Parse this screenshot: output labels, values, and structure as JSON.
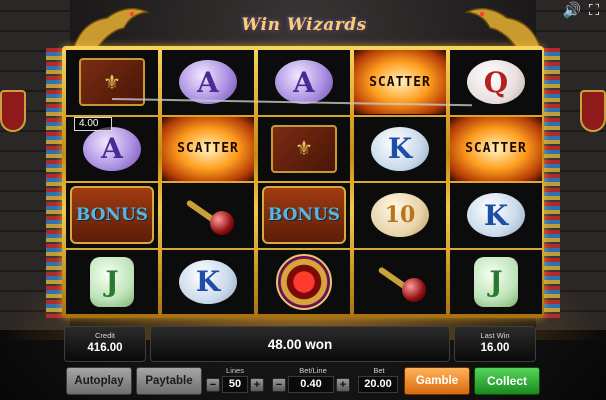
{
  "game": {
    "title": "Win Wizards"
  },
  "top_icons": {
    "sound": "speaker-icon",
    "fullscreen": "fullscreen-icon"
  },
  "reels": [
    [
      "book",
      "A",
      "bonus",
      "J"
    ],
    [
      "A",
      "scatter",
      "wand",
      "K"
    ],
    [
      "A",
      "book",
      "bonus",
      "amulet"
    ],
    [
      "scatter",
      "K",
      "10",
      "wand"
    ],
    [
      "Q",
      "scatter",
      "K",
      "J"
    ]
  ],
  "symbol_labels": {
    "A": "A",
    "K": "K",
    "Q": "Q",
    "J": "J",
    "10": "10",
    "scatter": "SCATTER",
    "bonus": "BONUS"
  },
  "win_line_badge": "4.00",
  "hud": {
    "credit_label": "Credit",
    "credit_value": "416.00",
    "won_text": "48.00 won",
    "last_win_label": "Last Win",
    "last_win_value": "16.00"
  },
  "controls": {
    "autoplay_label": "Autoplay",
    "paytable_label": "Paytable",
    "lines_label": "Lines",
    "lines_value": "50",
    "bet_line_label": "Bet/Line",
    "bet_line_value": "0.40",
    "bet_label": "Bet",
    "bet_value": "20.00",
    "gamble_label": "Gamble",
    "collect_label": "Collect",
    "minus": "−",
    "plus": "+"
  },
  "colors": {
    "gold_frame": "#f3c94b",
    "gamble_orange": "#d96a0f",
    "collect_green": "#1b8a1f"
  }
}
